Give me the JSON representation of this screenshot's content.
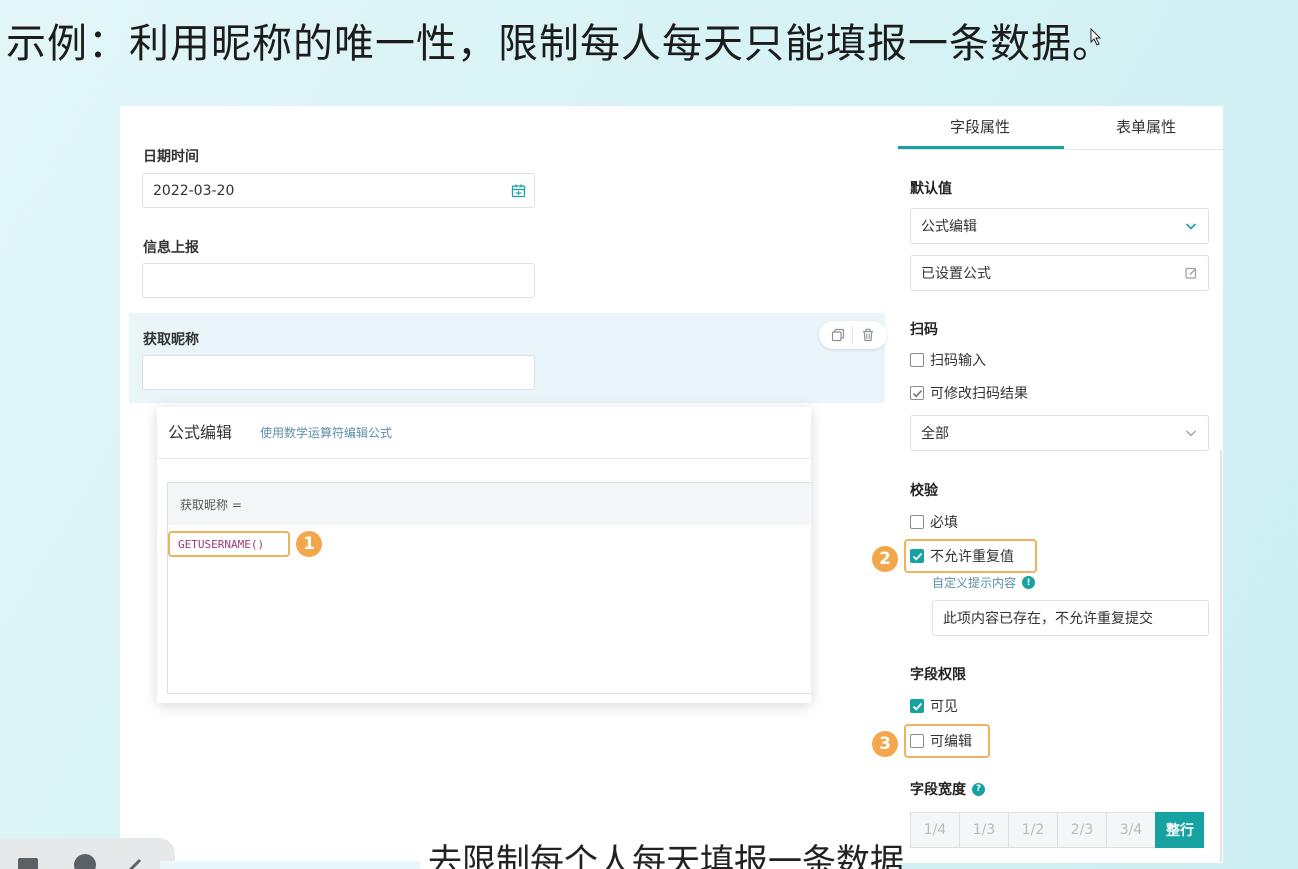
{
  "headline": "示例：利用昵称的唯一性，限制每人每天只能填报一条数据。",
  "form": {
    "date_label": "日期时间",
    "date_value": "2022-03-20",
    "info_label": "信息上报",
    "nickname_label": "获取昵称"
  },
  "formula_popup": {
    "title": "公式编辑",
    "hint": "使用数学运算符编辑公式",
    "lhs": "获取昵称 =",
    "code": "GETUSERNAME()"
  },
  "steps": [
    "1",
    "2",
    "3"
  ],
  "panel": {
    "tabs": [
      "字段属性",
      "表单属性"
    ],
    "default_value": {
      "title": "默认值",
      "mode": "公式编辑",
      "formula_status": "已设置公式"
    },
    "scan": {
      "title": "扫码",
      "scan_input": "扫码输入",
      "editable_result": "可修改扫码结果",
      "scope": "全部"
    },
    "validation": {
      "title": "校验",
      "required": "必填",
      "no_duplicates": "不允许重复值",
      "custom_tip_label": "自定义提示内容",
      "custom_tip_value": "此项内容已存在，不允许重复提交"
    },
    "permission": {
      "title": "字段权限",
      "visible": "可见",
      "editable": "可编辑"
    },
    "width": {
      "title": "字段宽度",
      "options": [
        "1/4",
        "1/3",
        "1/2",
        "2/3",
        "3/4",
        "整行"
      ],
      "selected": "整行"
    }
  },
  "subtitle": "去限制每个人每天填报一条数据",
  "colors": {
    "accent": "#17a2a2",
    "highlight": "#f2b25c",
    "badge": "#f3a64a"
  }
}
